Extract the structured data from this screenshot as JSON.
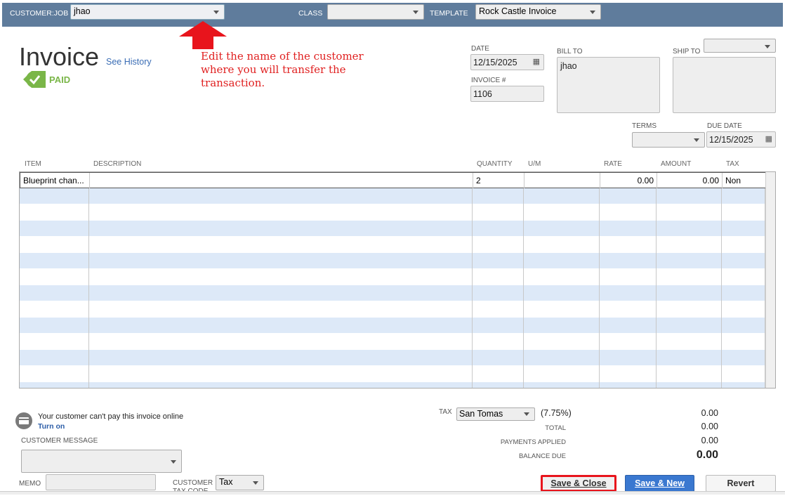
{
  "header": {
    "customer_job_label": "CUSTOMER:JOB",
    "customer_job_value": "jhao",
    "class_label": "CLASS",
    "class_value": "",
    "template_label": "TEMPLATE",
    "template_value": "Rock Castle Invoice"
  },
  "invoice": {
    "title": "Invoice",
    "see_history": "See History",
    "status": "PAID",
    "status_color": "#7ab648",
    "date_label": "DATE",
    "date": "12/15/2025",
    "invoice_no_label": "INVOICE #",
    "invoice_no": "1106",
    "bill_to_label": "BILL TO",
    "bill_to": "jhao",
    "ship_to_label": "SHIP TO",
    "terms_label": "TERMS",
    "terms": "",
    "due_date_label": "DUE DATE",
    "due_date": "12/15/2025"
  },
  "annotation": {
    "text": "Edit the name of the customer where you will transfer the transaction.",
    "color": "#e02020"
  },
  "table": {
    "columns": [
      "ITEM",
      "DESCRIPTION",
      "QUANTITY",
      "U/M",
      "RATE",
      "AMOUNT",
      "TAX"
    ],
    "rows": [
      {
        "item": "Blueprint chan...",
        "description": "",
        "quantity": "2",
        "um": "",
        "rate": "0.00",
        "amount": "0.00",
        "tax": "Non"
      }
    ]
  },
  "footer": {
    "online_pay_text": "Your customer can't pay this invoice online",
    "turn_on": "Turn on",
    "customer_message_label": "CUSTOMER MESSAGE",
    "memo_label": "MEMO",
    "customer_tax_code_label": "CUSTOMER TAX CODE",
    "customer_tax_code": "Tax",
    "tax_label": "TAX",
    "tax_item": "San Tomas",
    "tax_rate": "(7.75%)",
    "tax_amount": "0.00",
    "total_label": "TOTAL",
    "total": "0.00",
    "payments_applied_label": "PAYMENTS APPLIED",
    "payments_applied": "0.00",
    "balance_due_label": "BALANCE DUE",
    "balance_due": "0.00"
  },
  "buttons": {
    "save_close": "Save & Close",
    "save_new": "Save & New",
    "revert": "Revert"
  }
}
